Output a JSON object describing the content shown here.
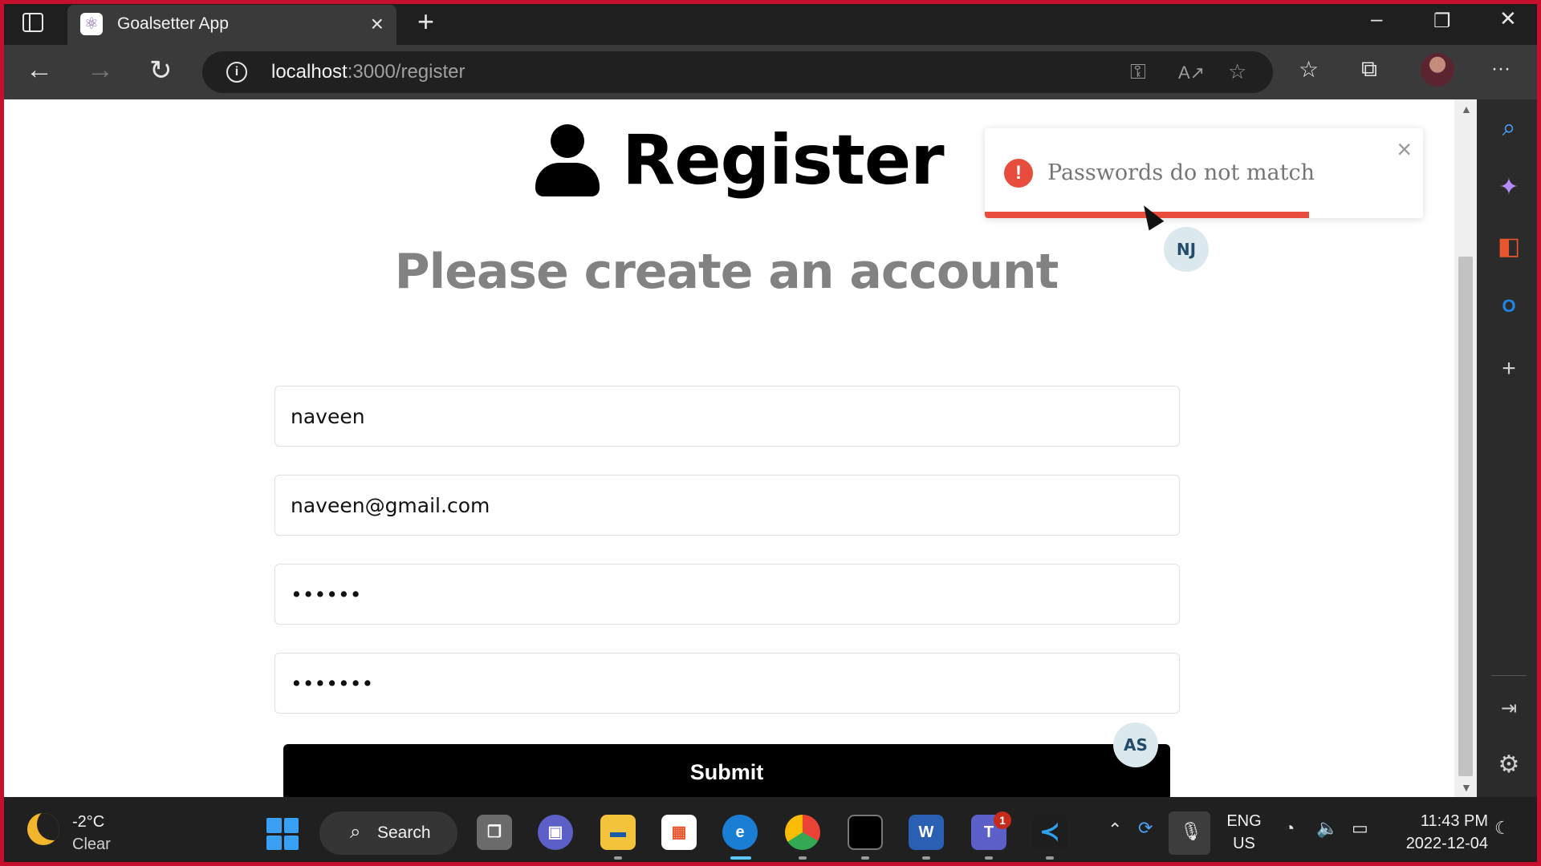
{
  "browser": {
    "tab": {
      "title": "Goalsetter App"
    },
    "url": {
      "host": "localhost",
      "path": ":3000/register"
    }
  },
  "page": {
    "heading": "Register",
    "subheading": "Please create an account",
    "form": {
      "name": "naveen",
      "email": "naveen@gmail.com",
      "password": "••••••",
      "password_confirm": "•••••••",
      "submit_label": "Submit"
    },
    "toast": {
      "message": "Passwords do not match",
      "close": "×",
      "progress_fraction": 0.74,
      "color": "#e74c3c"
    },
    "avatars": {
      "top": "NJ",
      "bottom": "AS"
    }
  },
  "taskbar": {
    "weather": {
      "temp": "-2°C",
      "condition": "Clear"
    },
    "search_label": "Search",
    "lang": {
      "line1": "ENG",
      "line2": "US"
    },
    "clock": {
      "time": "11:43 PM",
      "date": "2022-12-04"
    },
    "teams_badge": "1"
  },
  "icons": {
    "tab_close": "×",
    "new_tab": "+",
    "back": "←",
    "forward": "→",
    "reload": "↻",
    "info": "i",
    "minimize": "–",
    "maximize": "❐",
    "close": "✕",
    "more": "···"
  }
}
